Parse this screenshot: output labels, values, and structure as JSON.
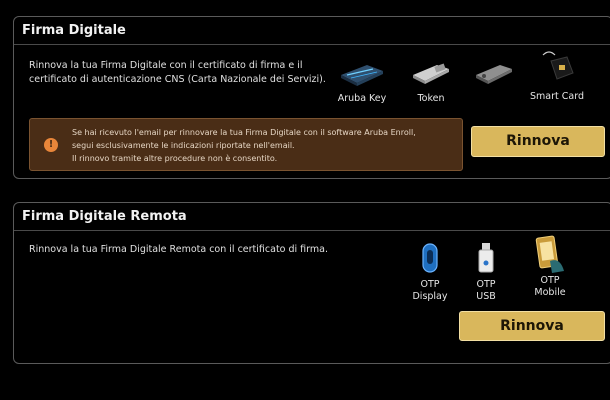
{
  "firma_digitale": {
    "title": "Firma Digitale",
    "description": "Rinnova la tua Firma Digitale con il certificato di firma e il certificato di autenticazione CNS (Carta Nazionale dei Servizi).",
    "devices": [
      {
        "label": "Aruba Key",
        "icon": "aruba-key-icon"
      },
      {
        "label": "Token",
        "icon": "token-icon"
      },
      {
        "label": "Smart Card",
        "icon": "smart-card-icon"
      }
    ],
    "notice": {
      "line1": "Se hai ricevuto l'email per rinnovare la tua Firma Digitale con il software Aruba Enroll,",
      "line2": "segui esclusivamente le indicazioni riportate nell'email.",
      "line3": "Il rinnovo tramite altre procedure non è consentito."
    },
    "button_label": "Rinnova"
  },
  "firma_remota": {
    "title": "Firma Digitale Remota",
    "description": "Rinnova la tua Firma Digitale Remota con il certificato di firma.",
    "devices": [
      {
        "line1": "OTP",
        "line2": "Display",
        "icon": "otp-display-icon"
      },
      {
        "line1": "OTP",
        "line2": "USB",
        "icon": "otp-usb-icon"
      },
      {
        "line1": "OTP",
        "line2": "Mobile",
        "icon": "otp-mobile-icon"
      }
    ],
    "button_label": "Rinnova"
  },
  "colors": {
    "button_bg": "#d9b75c",
    "notice_bg": "#4a2d16",
    "info_icon": "#e8863a",
    "border": "#5a5a5a"
  }
}
